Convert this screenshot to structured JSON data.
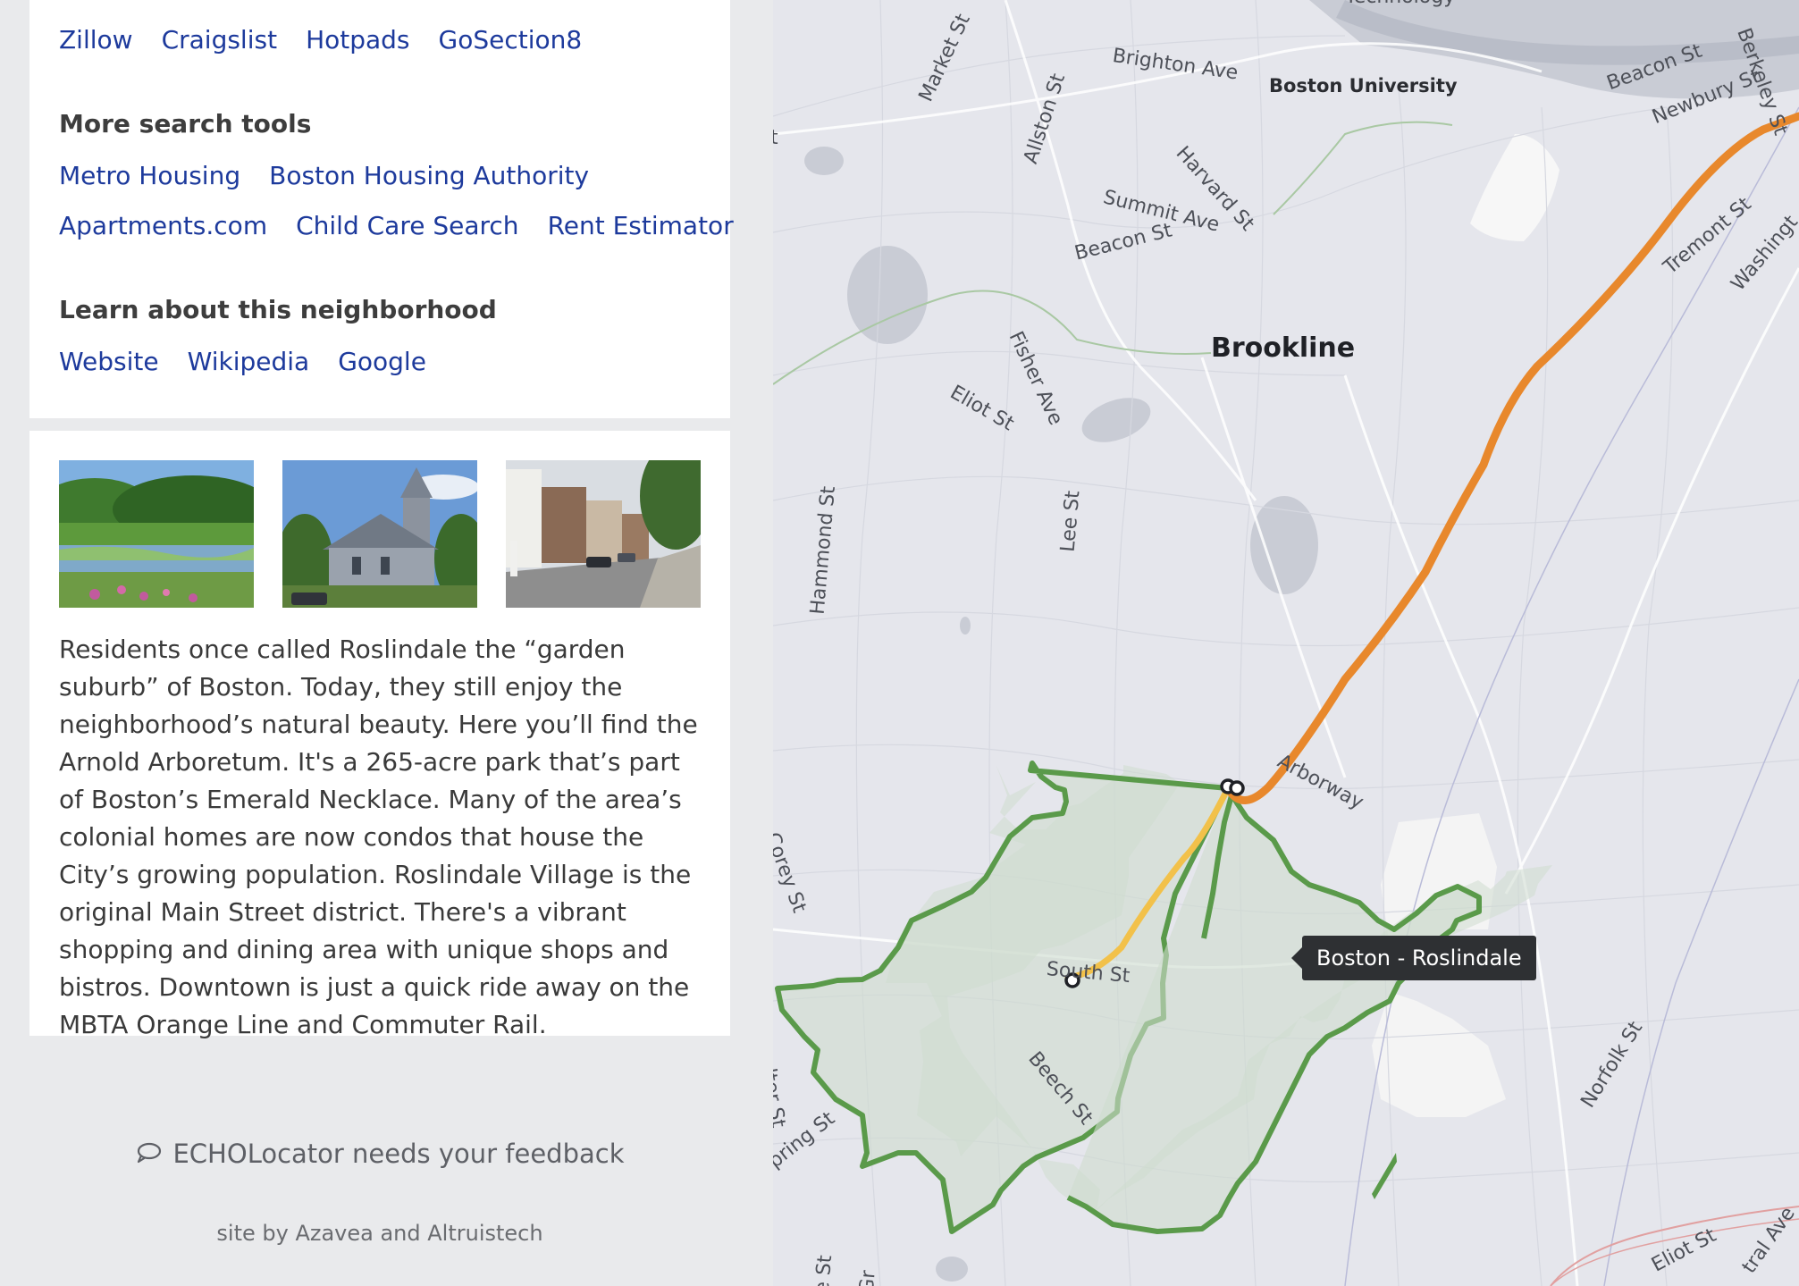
{
  "links_card": {
    "primary_links": [
      "Zillow",
      "Craigslist",
      "Hotpads",
      "GoSection8"
    ],
    "more_tools_heading": "More search tools",
    "more_tools_row1": [
      "Metro Housing",
      "Boston Housing Authority"
    ],
    "more_tools_row2": [
      "Apartments.com",
      "Child Care Search",
      "Rent Estimator"
    ],
    "learn_heading": "Learn about this neighborhood",
    "learn_links": [
      "Website",
      "Wikipedia",
      "Google"
    ]
  },
  "about_card": {
    "description": "Residents once called Roslindale the “garden suburb” of Boston. Today, they still enjoy the neighborhood’s natural beauty. Here you’ll find the Arnold Arboretum. It's a 265-acre park that’s part of Boston’s Emerald Necklace. Many of the area’s colonial homes are now condos that house the City’s growing population. Roslindale Village is the original Main Street district. There's a vibrant shopping and dining area with unique shops and bistros. Downtown is just a quick ride away on the MBTA Orange Line and Commuter Rail."
  },
  "footer": {
    "feedback_text": "ECHOLocator needs your feedback",
    "feedback_icon": "speech-bubble-icon",
    "credit": "site by Azavea and Altruistech"
  },
  "map": {
    "tooltip": "Boston - Roslindale",
    "labels": {
      "brookline": "Brookline",
      "boston_university": "Boston University",
      "brighton_ave": "Brighton Ave",
      "market_st": "Market St",
      "allston_st": "Allston St",
      "harvard_st": "Harvard St",
      "summit_ave": "Summit Ave",
      "beacon_st_1": "Beacon St",
      "beacon_st_2": "Beacon St",
      "newbury_st": "Newbury St",
      "berkeley_st": "Berkeley St",
      "tremont_st": "Tremont St",
      "washington": "Washingt",
      "fisher_ave": "Fisher Ave",
      "eliot_st_1": "Eliot St",
      "eliot_st_2": "Eliot St",
      "hammond_st": "Hammond St",
      "lee_st": "Lee St",
      "arborway": "Arborway",
      "corey_st": "Corey St",
      "south_st": "South St",
      "beech_st": "Beech St",
      "spring_st": "pring St",
      "norfolk_st": "Norfolk St",
      "central_ave": "tral Ave",
      "walter_st": "alter St",
      "st_edge": "t",
      "gr_edge": "Gr",
      "e_st": "e St",
      "technology": "Technology"
    },
    "colors": {
      "orange_line": "#e8882c",
      "branch_line": "#f2c14a",
      "neighborhood_outline": "#5a9a4a",
      "neighborhood_fill": "#cfdccf",
      "water": "#c9ccd5",
      "park": "#f4f4f4"
    }
  }
}
